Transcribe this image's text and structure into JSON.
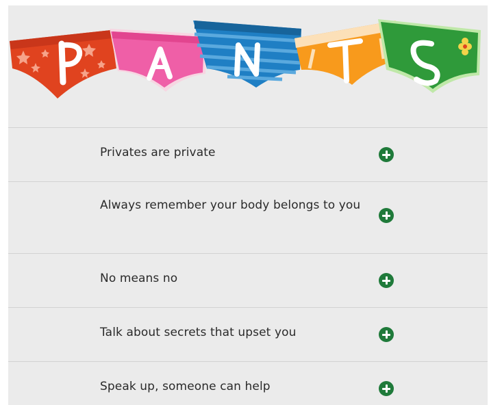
{
  "banner": {
    "letters": [
      "P",
      "A",
      "N",
      "T",
      "S"
    ],
    "colors": {
      "orange_red": "#e0431f",
      "pink": "#ef5fa7",
      "blue": "#1f7fc4",
      "orange": "#f89a1c",
      "green": "#2f9a3a",
      "accent_green": "#1f7a3a"
    }
  },
  "items": [
    {
      "label": "Privates are private",
      "icon": "plus-circle-icon"
    },
    {
      "label": "Always remember your body belongs to you",
      "icon": "plus-circle-icon"
    },
    {
      "label": "No means no",
      "icon": "plus-circle-icon"
    },
    {
      "label": "Talk about secrets that upset you",
      "icon": "plus-circle-icon"
    },
    {
      "label": "Speak up, someone can help",
      "icon": "plus-circle-icon"
    }
  ]
}
